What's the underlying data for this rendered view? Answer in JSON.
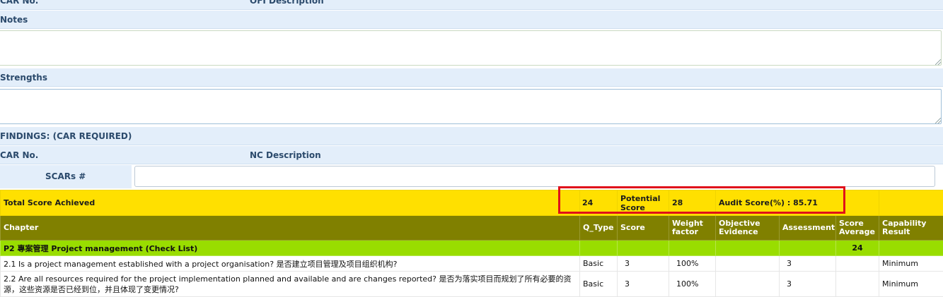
{
  "ofi_header": {
    "car_no": "CAR No.",
    "description": "OFI Description"
  },
  "notes": {
    "label": "Notes",
    "value": ""
  },
  "strengths": {
    "label": "Strengths",
    "value": ""
  },
  "findings": {
    "label": "FINDINGS: (CAR REQUIRED)",
    "car_no": "CAR No.",
    "nc_description": "NC Description",
    "scars_label": "SCARs #",
    "scars_value": ""
  },
  "total": {
    "label": "Total Score Achieved",
    "achieved": "24",
    "potential_label": "Potential Score",
    "potential": "28",
    "audit_score": "Audit Score(%) : 85.71"
  },
  "columns": {
    "chapter": "Chapter",
    "q_type": "Q_Type",
    "score": "Score",
    "weight": "Weight factor",
    "evidence": "Objective Evidence",
    "assessment": "Assessment",
    "avg": "Score Average",
    "capability": "Capability Result"
  },
  "chapter_row": {
    "title": "P2 專案管理 Project management (Check List)",
    "avg": "24"
  },
  "questions": [
    {
      "text": "2.1 Is a project management established with a project organisation? 是否建立项目管理及项目组织机构?",
      "q_type": "Basic",
      "score": "3",
      "weight": "100%",
      "evidence": "",
      "assessment": "3",
      "avg": "",
      "capability": "Minimum"
    },
    {
      "text": "2.2 Are all resources required for the project implementation planned and available and are changes reported? 是否为落实项目而规划了所有必要的资源，这些资源是否已经到位，并且体现了变更情况?",
      "q_type": "Basic",
      "score": "3",
      "weight": "100%",
      "evidence": "",
      "assessment": "3",
      "avg": "",
      "capability": "Minimum"
    }
  ],
  "colors": {
    "total_bg": "#ffe000",
    "header_bg": "#808000",
    "chapter_bg": "#99dd00",
    "highlight": "#e0101a"
  }
}
